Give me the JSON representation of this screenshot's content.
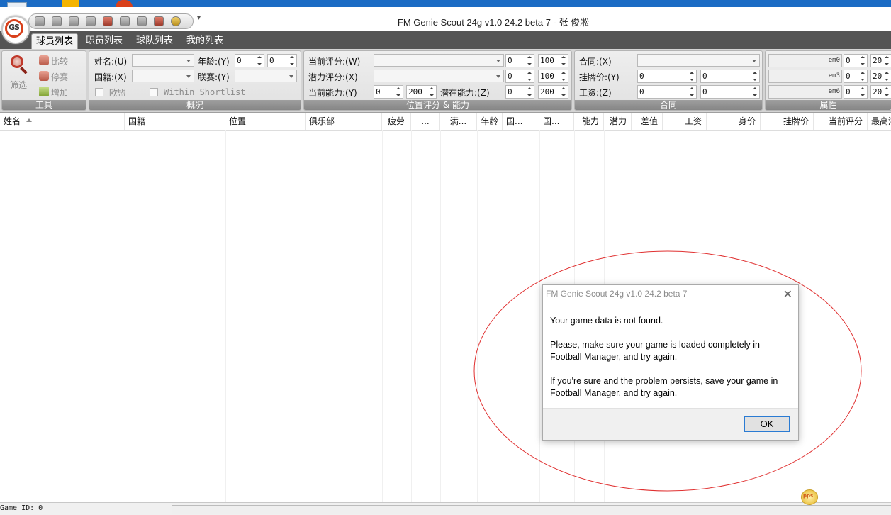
{
  "window": {
    "title": "FM Genie Scout 24g v1.0 24.2 beta 7 - 张 俊凇",
    "logo_text": "GS"
  },
  "quick_access": {
    "icons": [
      "toolbar-icon",
      "toolbar-icon",
      "toolbar-icon",
      "toolbar-icon",
      "toolbar-icon",
      "toolbar-icon",
      "toolbar-icon",
      "toolbar-icon",
      "toolbar-icon"
    ],
    "more": "▾"
  },
  "tabs": [
    {
      "label": "球员列表",
      "active": true
    },
    {
      "label": "职员列表",
      "active": false
    },
    {
      "label": "球队列表",
      "active": false
    },
    {
      "label": "我的列表",
      "active": false
    }
  ],
  "ribbon": {
    "tools": {
      "caption": "工具",
      "filter_label": "筛选",
      "compare_label": "比较",
      "suspend_label": "停赛",
      "add_label": "增加"
    },
    "overview": {
      "caption": "概况",
      "name_label": "姓名:(U)",
      "age_label": "年龄:(Y)",
      "age_min": "0",
      "age_max": "0",
      "nation_label": "国籍:(X)",
      "league_label": "联赛:(Y)",
      "eu_label": "欧盟",
      "shortlist_label": "Within Shortlist"
    },
    "position": {
      "caption": "位置评分 & 能力",
      "current_rating_label": "当前评分:(W)",
      "potential_rating_label": "潜力评分:(X)",
      "current_ability_label": "当前能力:(Y)",
      "potential_ability_label": "潜在能力:(Z)",
      "cur_rating_min": "0",
      "cur_rating_max": "100",
      "pot_rating_min": "0",
      "pot_rating_max": "100",
      "ca_min": "0",
      "ca_max": "200",
      "pa_min": "0",
      "pa_max": "200"
    },
    "contract": {
      "caption": "合同",
      "contract_label": "合同:(X)",
      "asking_price_label": "挂牌价:(Y)",
      "wage_label": "工资:(Z)",
      "price_min": "0",
      "price_max": "0",
      "wage_min": "0",
      "wage_max": "0"
    },
    "attributes": {
      "caption": "属性",
      "rows": [
        {
          "field": "em0",
          "min": "0",
          "max": "20"
        },
        {
          "field": "em3",
          "min": "0",
          "max": "20"
        },
        {
          "field": "em6",
          "min": "0",
          "max": "20"
        }
      ]
    }
  },
  "grid": {
    "columns": [
      {
        "label": "姓名"
      },
      {
        "label": "国籍"
      },
      {
        "label": "位置"
      },
      {
        "label": "俱乐部"
      },
      {
        "label": "疲劳"
      },
      {
        "label": "..."
      },
      {
        "label": "满..."
      },
      {
        "label": "年龄"
      },
      {
        "label": "国..."
      },
      {
        "label": "国..."
      },
      {
        "label": "能力"
      },
      {
        "label": "潜力"
      },
      {
        "label": "差值"
      },
      {
        "label": "工资"
      },
      {
        "label": "身价"
      },
      {
        "label": "挂牌价"
      },
      {
        "label": "当前评分"
      },
      {
        "label": "最高潜"
      }
    ]
  },
  "status": {
    "game_id": "Game ID: 0"
  },
  "dialog": {
    "title": "FM Genie Scout 24g v1.0 24.2 beta 7",
    "close": "✕",
    "message_1": "Your game data is not found.",
    "message_2": "Please, make sure your game is loaded completely in Football Manager, and try again.",
    "message_3": "If you're sure and the problem persists, save your game in Football Manager, and try again.",
    "ok_label": "OK"
  },
  "watermark": {
    "text": "pps"
  },
  "colors": {
    "tabbar": "#545454",
    "annotation": "#e03030",
    "ok_border": "#2a7bd3"
  }
}
